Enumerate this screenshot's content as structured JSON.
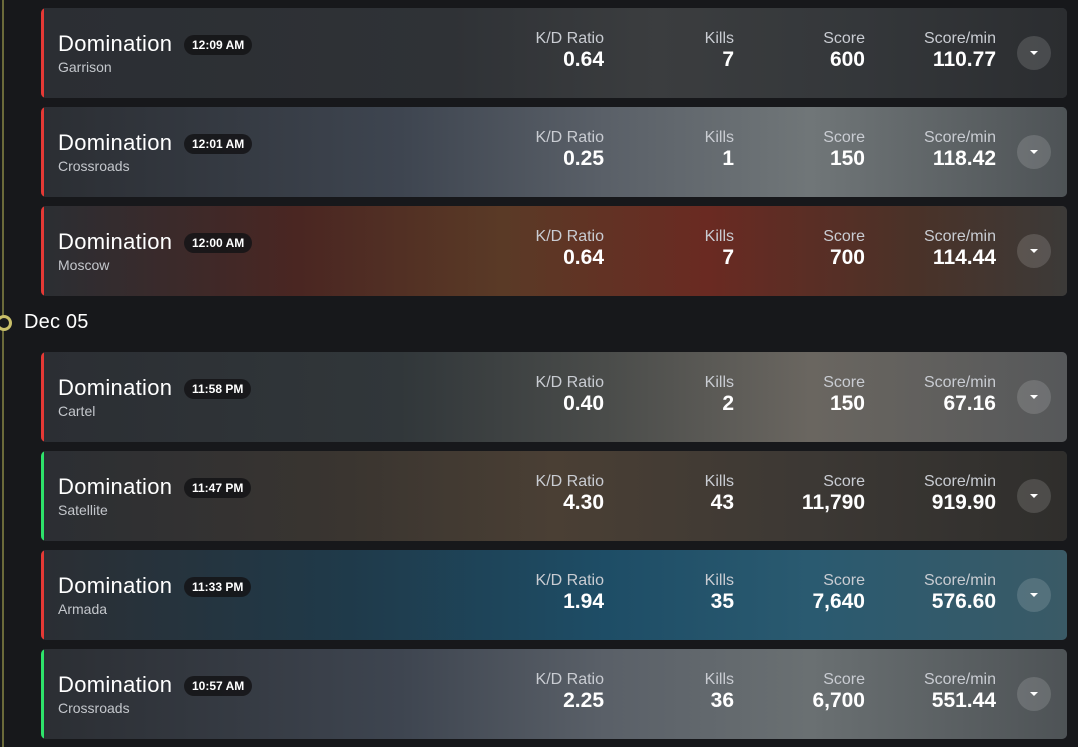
{
  "colors": {
    "loss": "#e53935",
    "win": "#2ee26a",
    "timeline": "#c9bf6a"
  },
  "icons": {
    "expand": "chevron-down-icon",
    "timeline": "timeline-dot-icon"
  },
  "timeline": {
    "date_header": "Dec 05"
  },
  "labels": {
    "kd": "K/D Ratio",
    "kills": "Kills",
    "score": "Score",
    "spm": "Score/min"
  },
  "matches": [
    {
      "mode": "Domination",
      "time": "12:09 AM",
      "map": "Garrison",
      "kd": "0.64",
      "kills": "7",
      "score": "600",
      "spm": "110.77",
      "result": "loss"
    },
    {
      "mode": "Domination",
      "time": "12:01 AM",
      "map": "Crossroads",
      "kd": "0.25",
      "kills": "1",
      "score": "150",
      "spm": "118.42",
      "result": "loss"
    },
    {
      "mode": "Domination",
      "time": "12:00 AM",
      "map": "Moscow",
      "kd": "0.64",
      "kills": "7",
      "score": "700",
      "spm": "114.44",
      "result": "loss"
    },
    {
      "mode": "Domination",
      "time": "11:58 PM",
      "map": "Cartel",
      "kd": "0.40",
      "kills": "2",
      "score": "150",
      "spm": "67.16",
      "result": "loss"
    },
    {
      "mode": "Domination",
      "time": "11:47 PM",
      "map": "Satellite",
      "kd": "4.30",
      "kills": "43",
      "score": "11,790",
      "spm": "919.90",
      "result": "win"
    },
    {
      "mode": "Domination",
      "time": "11:33 PM",
      "map": "Armada",
      "kd": "1.94",
      "kills": "35",
      "score": "7,640",
      "spm": "576.60",
      "result": "loss"
    },
    {
      "mode": "Domination",
      "time": "10:57 AM",
      "map": "Crossroads",
      "kd": "2.25",
      "kills": "36",
      "score": "6,700",
      "spm": "551.44",
      "result": "win"
    }
  ]
}
